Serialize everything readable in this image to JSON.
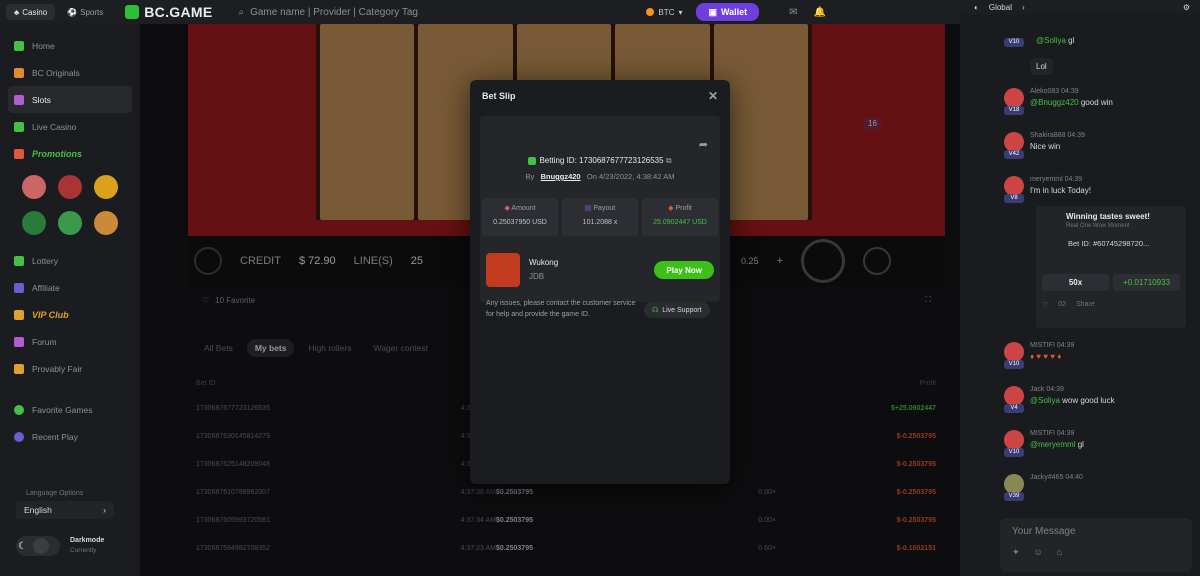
{
  "topbar": {
    "casino_label": "Casino",
    "sports_label": "Sports",
    "logo_text": "BC.GAME",
    "search_placeholder": "Game name | Provider | Category Tag",
    "currency": "BTC",
    "wallet_label": "Wallet"
  },
  "sidebar": {
    "items": [
      {
        "label": "Home",
        "color": "#44c144"
      },
      {
        "label": "BC Originals",
        "color": "#e08a30"
      },
      {
        "label": "Slots",
        "color": "#b05fd0"
      },
      {
        "label": "Live Casino",
        "color": "#44c144"
      },
      {
        "label": "Promotions",
        "color": "#e0593a"
      }
    ],
    "items2": [
      {
        "label": "Lottery",
        "color": "#44c144"
      },
      {
        "label": "Affiliate",
        "color": "#6a5fd0"
      },
      {
        "label": "VIP Club",
        "color": "#e0a030"
      },
      {
        "label": "Forum",
        "color": "#b05fd0"
      },
      {
        "label": "Provably Fair",
        "color": "#e0a030"
      }
    ],
    "items3": [
      {
        "label": "Favorite Games",
        "color": "#44c144"
      },
      {
        "label": "Recent Play",
        "color": "#6a5fd0"
      }
    ],
    "language_label": "Language Options",
    "language_value": "English",
    "darkmode_title": "Darkmode",
    "darkmode_sub": "Currently"
  },
  "game": {
    "credit_label": "CREDIT",
    "credit_value": "$ 72.90",
    "lines_label": "LINE(S)",
    "lines_value": "25",
    "bet_value": "0.25",
    "badge": "16",
    "favorite_label": "10 Favorite"
  },
  "bets": {
    "tabs": [
      "All Bets",
      "My bets",
      "High rollers",
      "Wager contest"
    ],
    "headers": {
      "id": "Bet ID",
      "time": "Time",
      "profit": "Profit"
    },
    "rows": [
      {
        "id": "1730687677723126535",
        "time": "4:38:42 AM",
        "pay": "",
        "mult": "",
        "profit": "$+25.0902447",
        "win": true
      },
      {
        "id": "1730687630145814279",
        "time": "4:37:57 AM",
        "pay": "",
        "mult": "",
        "profit": "$-0.2503795",
        "win": false
      },
      {
        "id": "1730687625148209048",
        "time": "4:37:52 AM",
        "pay": "",
        "mult": "",
        "profit": "$-0.2503795",
        "win": false
      },
      {
        "id": "1730687610788982007",
        "time": "4:37:38 AM",
        "pay": "$0.2503795",
        "mult": "0.00×",
        "profit": "$-0.2503795",
        "win": false
      },
      {
        "id": "1730687605993720581",
        "time": "4:37:34 AM",
        "pay": "$0.2503795",
        "mult": "0.00×",
        "profit": "$-0.2503795",
        "win": false
      },
      {
        "id": "1730687594982708352",
        "time": "4:37:23 AM",
        "pay": "$0.2503795",
        "mult": "0.60×",
        "profit": "$-0.1002151",
        "win": false
      }
    ]
  },
  "modal": {
    "title": "Bet Slip",
    "betting_id_label": "Betting ID:",
    "betting_id": "1730687677723126535",
    "by_label": "By",
    "user": "Bnuggz420",
    "on_label": "On",
    "date": "4/23/2022, 4:38:42 AM",
    "amount_label": "Amount",
    "amount_value": "0.25037950 USD",
    "payout_label": "Payout",
    "payout_value": "101.2088 x",
    "profit_label": "Profit",
    "profit_value": "25.0902447 USD",
    "game_name": "Wukong",
    "provider": "JDB",
    "play_label": "Play Now",
    "issues_text": "Any issues, please contact the customer service for help and provide the game ID.",
    "support_label": "Live Support"
  },
  "chat": {
    "tab": "Global",
    "input_placeholder": "Your Message",
    "messages": [
      {
        "name": "",
        "level": "V10",
        "tag": "@Soliya",
        "text": "gl"
      },
      {
        "name": "",
        "level": "",
        "tag": "",
        "text": "Lol"
      },
      {
        "name": "Aleko083",
        "time": "04:39",
        "level": "V18",
        "tag": "@Bnuggz420",
        "text": "good win"
      },
      {
        "name": "Shakira888",
        "time": "04:39",
        "level": "V42",
        "tag": "",
        "text": "Nice win"
      },
      {
        "name": "meryemml",
        "time": "04:39",
        "level": "V8",
        "tag": "",
        "text": "I'm in luck Today!"
      },
      {
        "name": "MISTIFI",
        "time": "04:39",
        "level": "V10",
        "tag": "",
        "text": "♦ ♥ ♥ ♥ ♦"
      },
      {
        "name": "Jack",
        "time": "04:39",
        "level": "V4",
        "tag": "@Soliya",
        "text": "wow good luck"
      },
      {
        "name": "MISTIFI",
        "time": "04:39",
        "level": "V10",
        "tag": "@meryemml",
        "text": "gl"
      },
      {
        "name": "Jacky#465",
        "time": "04:40",
        "level": "V39",
        "tag": "",
        "text": ""
      }
    ],
    "card": {
      "title": "Winning tastes sweet!",
      "sub": "Real One Wow Moment",
      "bet_id": "Bet ID: #60745298720...",
      "multiplier": "50x",
      "win": "+0.01710933",
      "likes": "02",
      "share": "Share"
    }
  }
}
